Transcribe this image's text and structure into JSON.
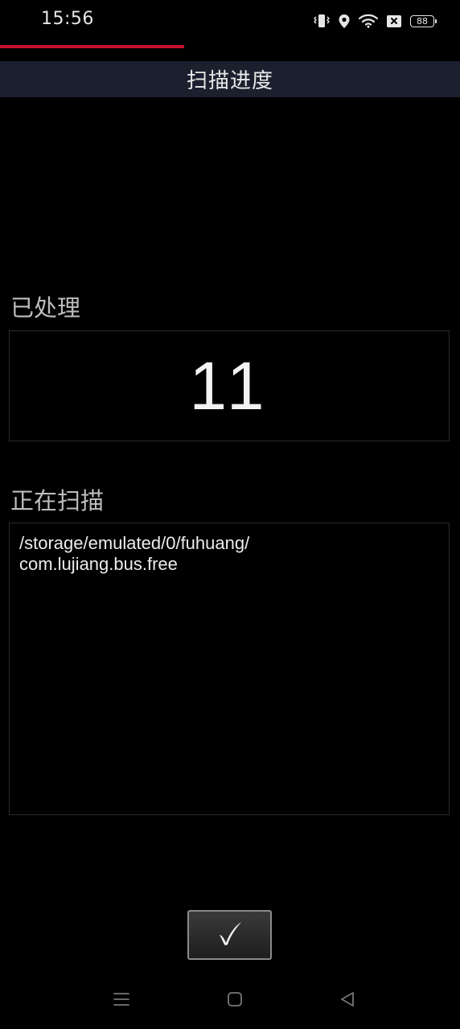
{
  "status_bar": {
    "time": "15:56",
    "battery": "88",
    "icons": [
      "vibrate-icon",
      "location-icon",
      "wifi-icon",
      "no-sim-icon",
      "battery-icon"
    ]
  },
  "progress": {
    "fraction": 0.4,
    "color": "#c8102e"
  },
  "header": {
    "title": "扫描进度",
    "background": "#1b1f2e"
  },
  "processed": {
    "label": "已处理",
    "count": "11"
  },
  "scanning": {
    "label": "正在扫描",
    "path": "/storage/emulated/0/fuhuang/\ncom.lujiang.bus.free"
  },
  "confirm_button": {
    "icon": "checkmark-icon"
  },
  "nav_bar": {
    "buttons": [
      "menu-icon",
      "home-icon",
      "back-icon"
    ]
  }
}
